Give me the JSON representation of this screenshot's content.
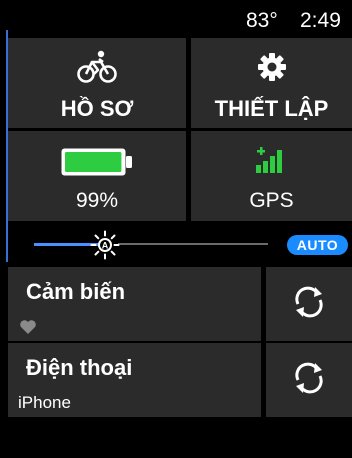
{
  "status": {
    "temperature": "83°",
    "time": "2:49"
  },
  "tiles": {
    "profile": {
      "label": "HỒ SƠ",
      "icon": "bicycle-icon"
    },
    "settings": {
      "label": "THIẾT LẬP",
      "icon": "gear-icon"
    },
    "battery": {
      "label": "99%",
      "icon": "battery-icon",
      "level": 0.99
    },
    "gps": {
      "label": "GPS",
      "icon": "gps-signal-icon"
    }
  },
  "brightness": {
    "auto_label": "AUTO",
    "level": 0.27,
    "icon": "sun-icon"
  },
  "rows": [
    {
      "title": "Cảm biến",
      "subtitle": "",
      "icon": "heart-icon",
      "action_icon": "sync-icon"
    },
    {
      "title": "Điện thoại",
      "subtitle": "iPhone",
      "action_icon": "sync-icon"
    }
  ],
  "colors": {
    "accent": "#1a8cff",
    "battery": "#2ecc40",
    "gps": "#2ecc40",
    "tile": "#2b2b2b"
  }
}
